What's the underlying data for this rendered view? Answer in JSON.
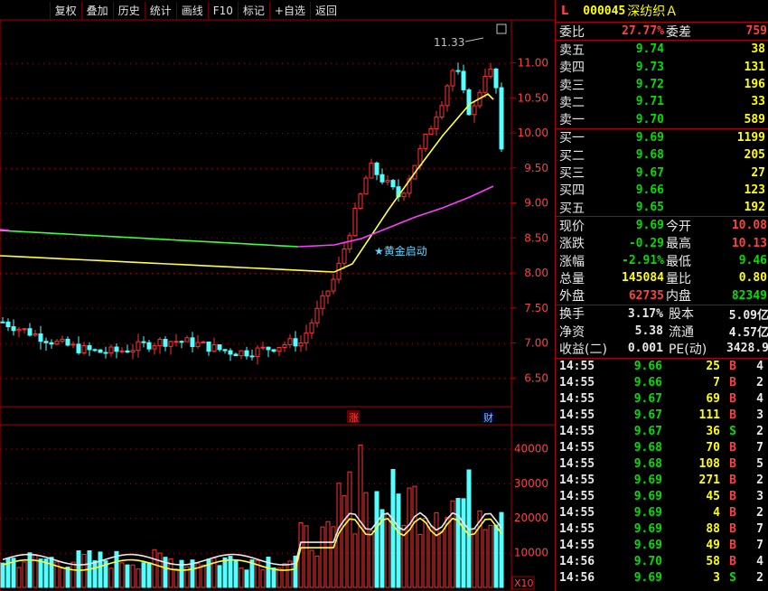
{
  "toolbar": [
    "复权",
    "叠加",
    "历史",
    "统计",
    "画线",
    "F10",
    "标记",
    "+自选",
    "返回"
  ],
  "price_axis": [
    "11.00",
    "10.50",
    "10.00",
    "9.50",
    "9.00",
    "8.50",
    "8.00",
    "7.50",
    "7.00",
    "6.50"
  ],
  "vol_axis": [
    "40000",
    "30000",
    "20000",
    "10000"
  ],
  "vol_unit": "X10",
  "high_label": "11.33",
  "signal_label": "★黄金启动",
  "marker_zhang": "涨",
  "marker_cai": "财",
  "stock": {
    "flag": "L",
    "code": "000045",
    "name": "深纺织Ａ"
  },
  "weibi": {
    "label1": "委比",
    "val1": "27.77%",
    "label2": "委差",
    "val2": "759"
  },
  "sells": [
    {
      "label": "卖五",
      "price": "9.74",
      "vol": "38"
    },
    {
      "label": "卖四",
      "price": "9.73",
      "vol": "131"
    },
    {
      "label": "卖三",
      "price": "9.72",
      "vol": "196"
    },
    {
      "label": "卖二",
      "price": "9.71",
      "vol": "33"
    },
    {
      "label": "卖一",
      "price": "9.70",
      "vol": "589"
    }
  ],
  "buys": [
    {
      "label": "买一",
      "price": "9.69",
      "vol": "1199"
    },
    {
      "label": "买二",
      "price": "9.68",
      "vol": "205"
    },
    {
      "label": "买三",
      "price": "9.67",
      "vol": "27"
    },
    {
      "label": "买四",
      "price": "9.66",
      "vol": "123"
    },
    {
      "label": "买五",
      "price": "9.65",
      "vol": "192"
    }
  ],
  "stats": [
    {
      "l1": "现价",
      "v1": "9.69",
      "c1": "green",
      "l2": "今开",
      "v2": "10.08",
      "c2": "red"
    },
    {
      "l1": "涨跌",
      "v1": "-0.29",
      "c1": "green",
      "l2": "最高",
      "v2": "10.13",
      "c2": "red"
    },
    {
      "l1": "涨幅",
      "v1": "-2.91%",
      "c1": "green",
      "l2": "最低",
      "v2": "9.46",
      "c2": "green"
    },
    {
      "l1": "总量",
      "v1": "145084",
      "c1": "yellow",
      "l2": "量比",
      "v2": "0.80",
      "c2": "yellow"
    },
    {
      "l1": "外盘",
      "v1": "62735",
      "c1": "red",
      "l2": "内盘",
      "v2": "82349",
      "c2": "green"
    }
  ],
  "fin": [
    {
      "l1": "换手",
      "v1": "3.17%",
      "l2": "股本",
      "v2": "5.09亿"
    },
    {
      "l1": "净资",
      "v1": "5.38",
      "l2": "流通",
      "v2": "4.57亿"
    },
    {
      "l1": "收益(二)",
      "v1": "0.001",
      "l2": "PE(动)",
      "v2": "3428.9"
    }
  ],
  "ticks": [
    {
      "t": "14:55",
      "p": "9.66",
      "pc": "green",
      "v": "25",
      "s": "B",
      "n": "4"
    },
    {
      "t": "14:55",
      "p": "9.66",
      "pc": "green",
      "v": "7",
      "s": "B",
      "n": "2"
    },
    {
      "t": "14:55",
      "p": "9.67",
      "pc": "green",
      "v": "69",
      "s": "B",
      "n": "4"
    },
    {
      "t": "14:55",
      "p": "9.67",
      "pc": "green",
      "v": "111",
      "s": "B",
      "n": "3"
    },
    {
      "t": "14:55",
      "p": "9.67",
      "pc": "green",
      "v": "36",
      "s": "S",
      "n": "2"
    },
    {
      "t": "14:55",
      "p": "9.68",
      "pc": "green",
      "v": "70",
      "s": "B",
      "n": "7"
    },
    {
      "t": "14:55",
      "p": "9.68",
      "pc": "green",
      "v": "108",
      "s": "B",
      "n": "5"
    },
    {
      "t": "14:55",
      "p": "9.69",
      "pc": "green",
      "v": "271",
      "s": "B",
      "n": "2"
    },
    {
      "t": "14:55",
      "p": "9.69",
      "pc": "green",
      "v": "45",
      "s": "B",
      "n": "3"
    },
    {
      "t": "14:55",
      "p": "9.69",
      "pc": "green",
      "v": "4",
      "s": "B",
      "n": "2"
    },
    {
      "t": "14:55",
      "p": "9.69",
      "pc": "green",
      "v": "88",
      "s": "B",
      "n": "7"
    },
    {
      "t": "14:55",
      "p": "9.69",
      "pc": "green",
      "v": "49",
      "s": "B",
      "n": "7"
    },
    {
      "t": "14:56",
      "p": "9.70",
      "pc": "green",
      "v": "58",
      "s": "B",
      "n": "4"
    },
    {
      "t": "14:56",
      "p": "9.69",
      "pc": "green",
      "v": "3",
      "s": "S",
      "n": "2"
    }
  ],
  "colors": {
    "up": "#ff3232",
    "down": "#54ffff",
    "ma_yellow": "#ffff3c",
    "ma_magenta": "#ff3cff",
    "ma_green": "#3cff3c"
  }
}
